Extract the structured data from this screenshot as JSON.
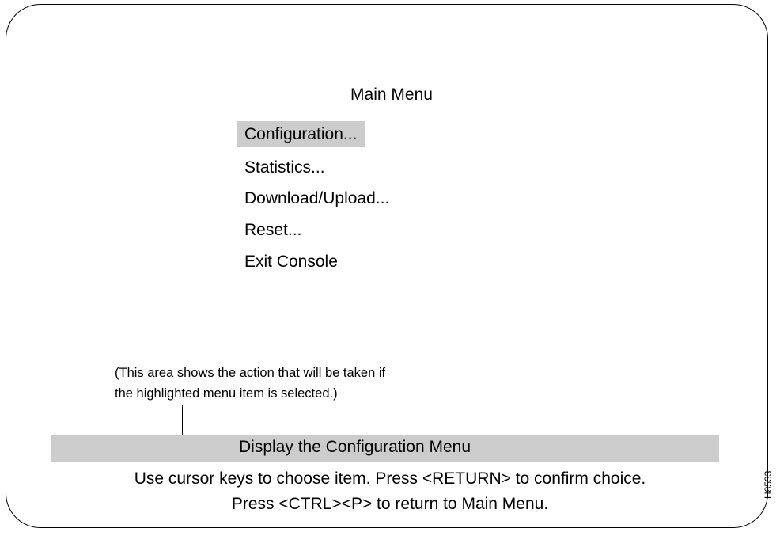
{
  "menu": {
    "title": "Main Menu",
    "items": [
      {
        "label": "Configuration...",
        "selected": true
      },
      {
        "label": "Statistics...",
        "selected": false
      },
      {
        "label": "Download/Upload...",
        "selected": false
      },
      {
        "label": "Reset...",
        "selected": false
      },
      {
        "label": "Exit Console",
        "selected": false
      }
    ]
  },
  "action_note": {
    "line1": "(This area shows the action that will be taken if",
    "line2": "the highlighted menu item is selected.)"
  },
  "status": {
    "action_text": "Display the Configuration Menu",
    "help_line1": "Use cursor keys to choose item.  Press <RETURN> to confirm choice.",
    "help_line2": "Press <CTRL><P> to return to Main Menu."
  },
  "figure_id": "H8533",
  "colors": {
    "highlight": "#cccccc",
    "border": "#000000",
    "background": "#ffffff"
  }
}
